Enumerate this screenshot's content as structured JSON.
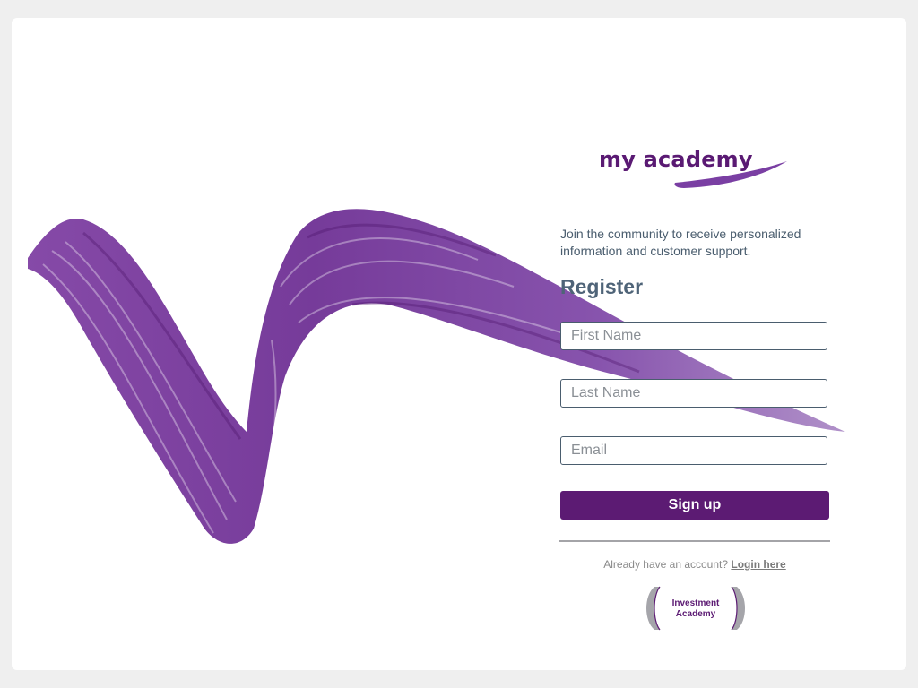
{
  "brand": {
    "logo_text": "my academy",
    "accent_color": "#5c1b73",
    "icon": "brush-swoosh-icon"
  },
  "intro": {
    "text": "Join the community to receive personalized information and customer support."
  },
  "form": {
    "heading": "Register",
    "first_name_placeholder": "First Name",
    "first_name_value": "",
    "last_name_placeholder": "Last Name",
    "last_name_value": "",
    "email_placeholder": "Email",
    "email_value": "",
    "submit_label": "Sign up"
  },
  "login": {
    "prompt": "Already have an account?",
    "link_label": "Login here"
  },
  "badge": {
    "line1": "Investment",
    "line2": "Academy",
    "icon": "bracket-frame-icon"
  }
}
